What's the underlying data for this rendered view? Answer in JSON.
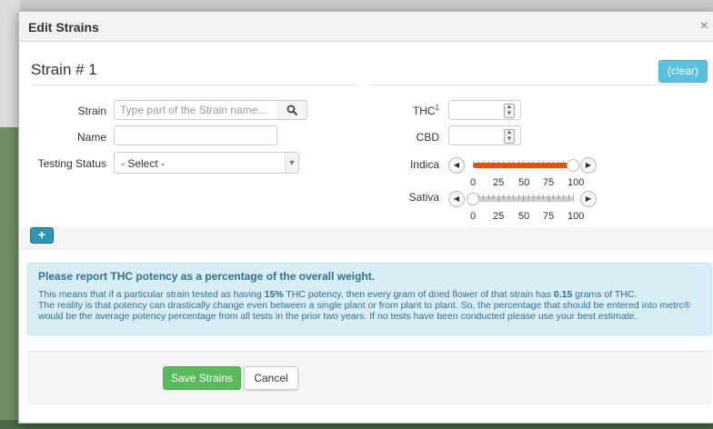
{
  "modal": {
    "title": "Edit Strains",
    "close": "×"
  },
  "strain": {
    "heading": "Strain # 1",
    "clear": "(clear)"
  },
  "form": {
    "strain_label": "Strain",
    "strain_placeholder": "Type part of the Strain name...",
    "name_label": "Name",
    "name_value": "",
    "testing_label": "Testing Status",
    "testing_value": "- Select -",
    "thc_label": "THC",
    "thc_sup": "1",
    "cbd_label": "CBD"
  },
  "sliders": {
    "ticks": [
      "0",
      "25",
      "50",
      "75",
      "100"
    ],
    "indica": {
      "label": "Indica",
      "value": 100
    },
    "sativa": {
      "label": "Sativa",
      "value": 0
    }
  },
  "add_button": "+",
  "info": {
    "title": "Please report THC potency as a percentage of the overall weight.",
    "line1_a": "This means that if a particular strain tested as having ",
    "line1_b": "15%",
    "line1_c": " THC potency, then every gram of dried flower of that strain has ",
    "line1_d": "0.15",
    "line1_e": " grams of THC.",
    "line2": "The reality is that potency can drastically change even between a single plant or from plant to plant. So, the percentage that should be entered into metrc® would be the average potency percentage from all tests in the prior two years. If no tests have been conducted please use your best estimate."
  },
  "footer": {
    "save": "Save Strains",
    "cancel": "Cancel"
  },
  "colors": {
    "indica_fill": "#e0510e",
    "sativa_fill": "#cfcfcf",
    "info_bg": "#d9edf7",
    "save_green": "#5cb85c",
    "clear_blue": "#5bc0de"
  },
  "icons": {
    "search": "search-icon",
    "left": "chevron-left-icon",
    "right": "chevron-right-icon",
    "dropdown": "chevron-down-icon"
  }
}
